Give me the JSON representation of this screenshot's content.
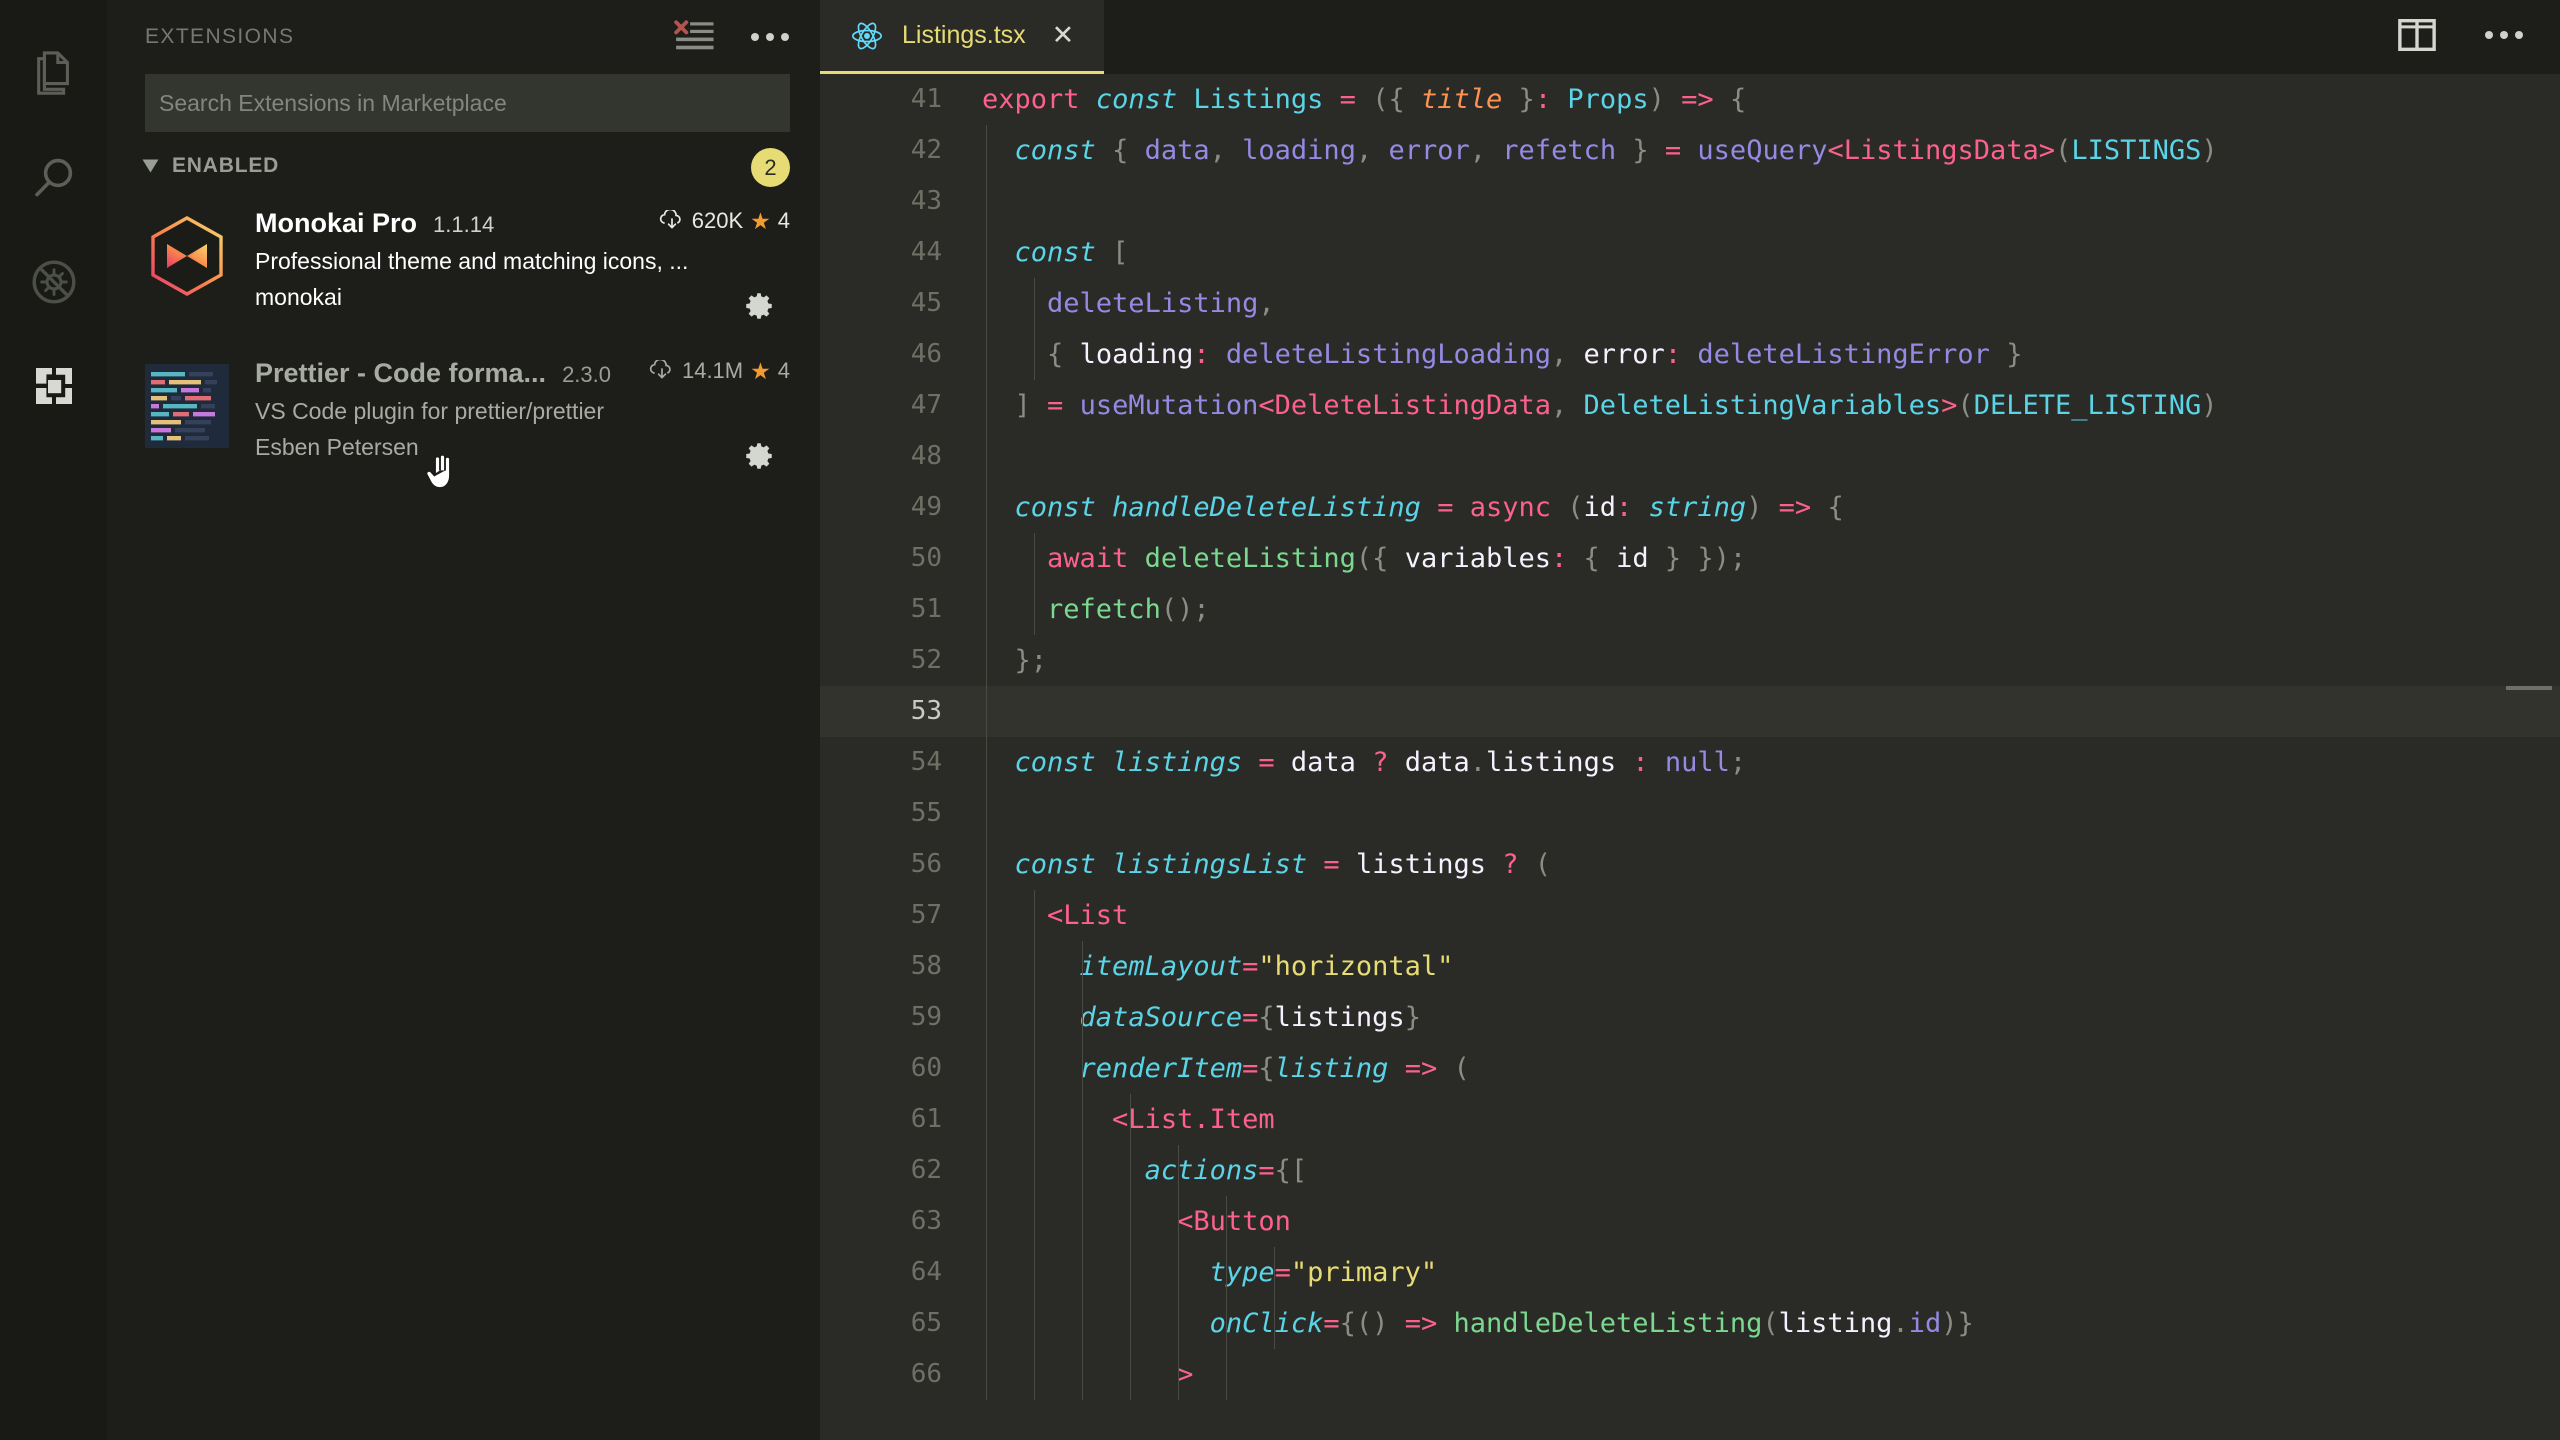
{
  "activity_bar": {
    "items": [
      {
        "name": "explorer-icon",
        "label": "Explorer"
      },
      {
        "name": "search-icon",
        "label": "Search"
      },
      {
        "name": "run-and-debug-disabled-icon",
        "label": "Run and Debug"
      },
      {
        "name": "extensions-icon",
        "label": "Extensions"
      }
    ]
  },
  "sidebar": {
    "title": "EXTENSIONS",
    "actions": [
      {
        "name": "clear-extensions-search-results-icon",
        "label": "Clear Extensions Search Results"
      },
      {
        "name": "views-and-more-actions-icon",
        "label": "Views and More Actions..."
      }
    ],
    "search": {
      "placeholder": "Search Extensions in Marketplace",
      "value": ""
    },
    "section": {
      "label": "ENABLED",
      "count": "2",
      "expanded": true
    },
    "extensions": [
      {
        "name": "Monokai Pro",
        "version": "1.1.14",
        "installs": "620K",
        "rating": "4",
        "description": "Professional theme and matching icons, ...",
        "publisher": "monokai",
        "icon": "monokai-pro-logo",
        "state": "active"
      },
      {
        "name": "Prettier - Code forma...",
        "version": "2.3.0",
        "installs": "14.1M",
        "rating": "4",
        "description": "VS Code plugin for prettier/prettier",
        "publisher": "Esben Petersen",
        "icon": "prettier-logo",
        "state": "normal"
      }
    ],
    "gear_label": "Manage"
  },
  "editor": {
    "tab": {
      "label": "Listings.tsx",
      "icon": "react-icon",
      "close": "✕",
      "active": true
    },
    "actions": [
      {
        "name": "split-editor-right-icon",
        "label": "Split Editor Right"
      },
      {
        "name": "more-actions-icon",
        "label": "More Actions..."
      }
    ],
    "current_line": 53,
    "first_line": 41,
    "lines": [
      {
        "n": 41,
        "indent": 0
      },
      {
        "n": 42,
        "indent": 1
      },
      {
        "n": 43,
        "indent": 1
      },
      {
        "n": 44,
        "indent": 1
      },
      {
        "n": 45,
        "indent": 2
      },
      {
        "n": 46,
        "indent": 2
      },
      {
        "n": 47,
        "indent": 1
      },
      {
        "n": 48,
        "indent": 1
      },
      {
        "n": 49,
        "indent": 1
      },
      {
        "n": 50,
        "indent": 2
      },
      {
        "n": 51,
        "indent": 2
      },
      {
        "n": 52,
        "indent": 1
      },
      {
        "n": 53,
        "indent": 1
      },
      {
        "n": 54,
        "indent": 1
      },
      {
        "n": 55,
        "indent": 1
      },
      {
        "n": 56,
        "indent": 1
      },
      {
        "n": 57,
        "indent": 2
      },
      {
        "n": 58,
        "indent": 3
      },
      {
        "n": 59,
        "indent": 3
      },
      {
        "n": 60,
        "indent": 3
      },
      {
        "n": 61,
        "indent": 4
      },
      {
        "n": 62,
        "indent": 5
      },
      {
        "n": 63,
        "indent": 6
      },
      {
        "n": 64,
        "indent": 7
      },
      {
        "n": 65,
        "indent": 7
      },
      {
        "n": 66,
        "indent": 6
      }
    ],
    "code": [
      "export const Listings = ({ title }: Props) => {",
      "  const { data, loading, error, refetch } = useQuery<ListingsData>(LISTINGS)",
      "",
      "  const [",
      "    deleteListing,",
      "    { loading: deleteListingLoading, error: deleteListingError }",
      "  ] = useMutation<DeleteListingData, DeleteListingVariables>(DELETE_LISTING)",
      "",
      "  const handleDeleteListing = async (id: string) => {",
      "    await deleteListing({ variables: { id } });",
      "    refetch();",
      "  };",
      "",
      "  const listings = data ? data.listings : null;",
      "",
      "  const listingsList = listings ? (",
      "    <List",
      "      itemLayout=\"horizontal\"",
      "      dataSource={listings}",
      "      renderItem={listing => (",
      "        <List.Item",
      "          actions={[",
      "            <Button",
      "              type=\"primary\"",
      "              onClick={() => handleDeleteListing(listing.id)}",
      "            >"
    ]
  }
}
